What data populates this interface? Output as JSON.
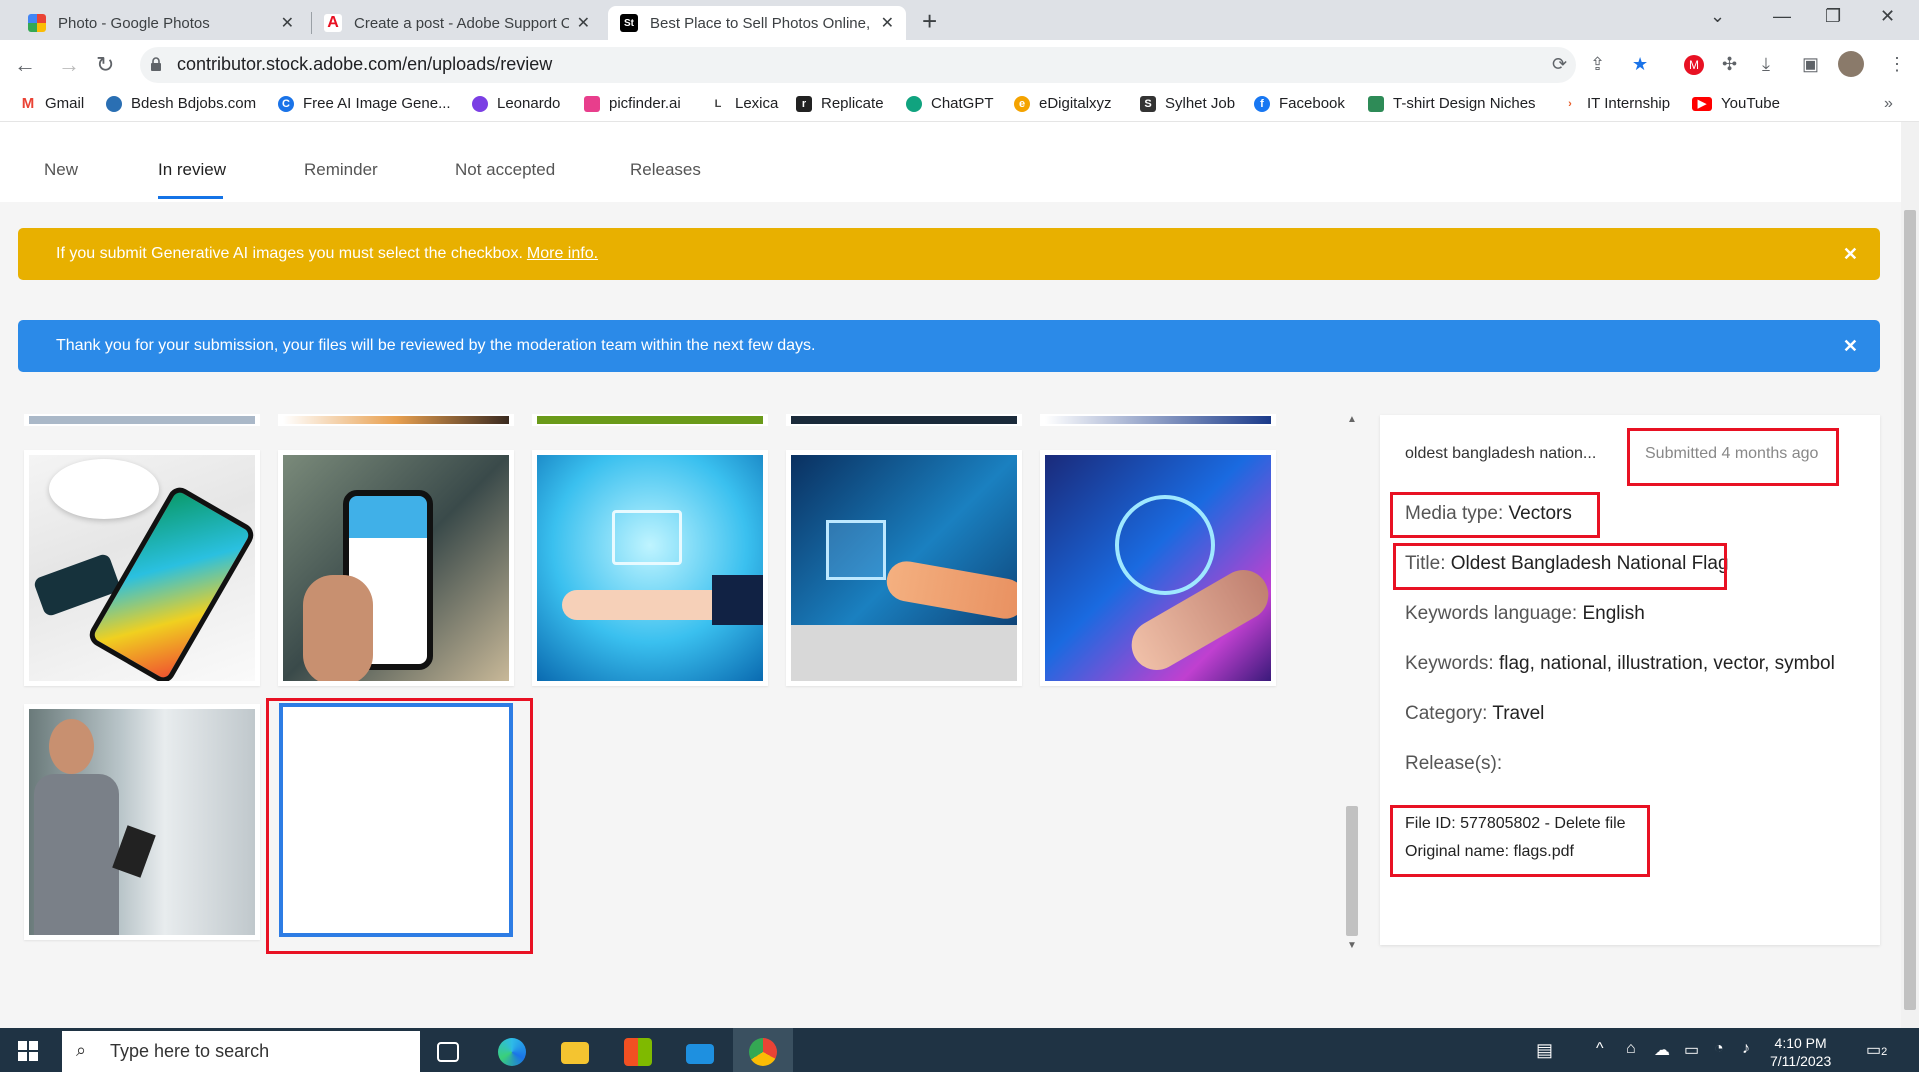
{
  "browser": {
    "tabs": [
      {
        "title": "Photo - Google Photos",
        "active": false
      },
      {
        "title": "Create a post - Adobe Support C",
        "active": false
      },
      {
        "title": "Best Place to Sell Photos Online,",
        "active": true
      }
    ],
    "url": "contributor.stock.adobe.com/en/uploads/review"
  },
  "bookmarks": [
    {
      "label": "Gmail",
      "icon": "gmail-icon",
      "color": "#ea4335"
    },
    {
      "label": "Bdesh Bdjobs.com",
      "icon": "bdjobs-icon",
      "color": "#2a6fb3"
    },
    {
      "label": "Free AI Image Gene...",
      "icon": "ai-image-icon",
      "color": "#1a73e8"
    },
    {
      "label": "Leonardo",
      "icon": "leonardo-icon",
      "color": "#7b3fe4"
    },
    {
      "label": "picfinder.ai",
      "icon": "picfinder-icon",
      "color": "#e83e8c"
    },
    {
      "label": "Lexica",
      "icon": "lexica-icon",
      "color": "#444444"
    },
    {
      "label": "Replicate",
      "icon": "replicate-icon",
      "color": "#222222"
    },
    {
      "label": "ChatGPT",
      "icon": "chatgpt-icon",
      "color": "#10a37f"
    },
    {
      "label": "eDigitalxyz",
      "icon": "edigital-icon",
      "color": "#f4a300"
    },
    {
      "label": "Sylhet Job",
      "icon": "sylhetjob-icon",
      "color": "#333333"
    },
    {
      "label": "Facebook",
      "icon": "facebook-icon",
      "color": "#1877f2"
    },
    {
      "label": "T-shirt Design Niches",
      "icon": "tshirt-icon",
      "color": "#2e8b57"
    },
    {
      "label": "IT Internship",
      "icon": "internship-icon",
      "color": "#e85d2a"
    },
    {
      "label": "YouTube",
      "icon": "youtube-icon",
      "color": "#ff0000"
    }
  ],
  "subnav": {
    "tabs": [
      "New",
      "In review",
      "Reminder",
      "Not accepted",
      "Releases"
    ],
    "active": "In review"
  },
  "banners": {
    "generative": {
      "text": "If you submit Generative AI images you must select the checkbox.",
      "link": "More info.",
      "color": "#e8b000"
    },
    "thanks": {
      "text": "Thank you for your submission, your files will be reviewed by the moderation team within the next few days.",
      "color": "#2b8ae8"
    }
  },
  "details": {
    "filename": "oldest bangladesh nation...",
    "submitted": "Submitted 4 months ago",
    "media_type_label": "Media type:",
    "media_type": "Vectors",
    "title_label": "Title:",
    "title": "Oldest Bangladesh National Flag",
    "keywords_language_label": "Keywords language:",
    "keywords_language": "English",
    "keywords_label": "Keywords:",
    "keywords": "flag, national, illustration, vector, symbol",
    "category_label": "Category:",
    "category": "Travel",
    "releases_label": "Release(s):",
    "file_id": "File ID: 577805802 - Delete file",
    "original_name": "Original name: flags.pdf"
  },
  "taskbar": {
    "search_placeholder": "Type here to search",
    "time": "4:10 PM",
    "date": "7/11/2023",
    "notifications": "2"
  },
  "colors": {
    "accent": "#1473e6",
    "highlight_red": "#e81123",
    "selected_blue": "#2d7ce4"
  }
}
